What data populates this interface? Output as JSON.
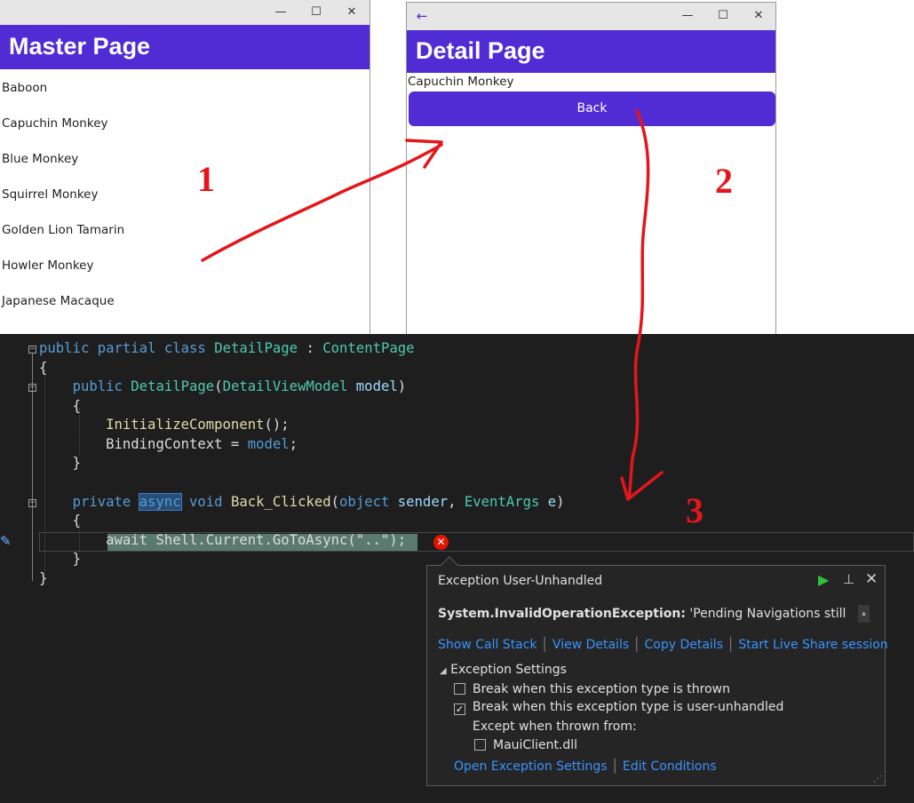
{
  "master_window": {
    "controls": [
      "—",
      "☐",
      "✕"
    ],
    "header": "Master Page",
    "items": [
      "Baboon",
      "Capuchin Monkey",
      "Blue Monkey",
      "Squirrel Monkey",
      "Golden Lion Tamarin",
      "Howler Monkey",
      "Japanese Macaque"
    ]
  },
  "detail_window": {
    "back_arrow": "←",
    "controls": [
      "—",
      "☐",
      "✕"
    ],
    "header": "Detail Page",
    "name": "Capuchin Monkey",
    "back_button": "Back"
  },
  "annotations": [
    "1",
    "2",
    "3"
  ],
  "code": {
    "l1_public": "public",
    "l1_partial": "partial",
    "l1_class": "class",
    "l1_name": "DetailPage",
    "l1_colon": " : ",
    "l1_base": "ContentPage",
    "l2": "{",
    "l3_public": "public",
    "l3_ctor": "DetailPage",
    "l3_open": "(",
    "l3_type": "DetailViewModel",
    "l3_param": "model",
    "l3_close": ")",
    "l4": "{",
    "l5_call": "InitializeComponent",
    "l5_rest": "();",
    "l6_prop": "BindingContext = ",
    "l6_val": "model",
    "l6_end": ";",
    "l7": "}",
    "l8_private": "private",
    "l8_async": "async",
    "l8_void": "void",
    "l8_method": "Back_Clicked",
    "l8_open": "(",
    "l8_object": "object",
    "l8_sender": "sender",
    "l8_comma": ", ",
    "l8_eventargs": "EventArgs",
    "l8_e": "e",
    "l8_close": ")",
    "l9": "{",
    "l10": "await Shell.Current.GoToAsync(\"..\");",
    "l11": "}",
    "l12": "}"
  },
  "exception": {
    "title": "Exception User-Unhandled",
    "type": "System.InvalidOperationException:",
    "message": "'Pending Navigations still",
    "links": [
      "Show Call Stack",
      "View Details",
      "Copy Details",
      "Start Live Share session"
    ],
    "settings_label": "Exception Settings",
    "break_thrown": "Break when this exception type is thrown",
    "break_unhandled": "Break when this exception type is user-unhandled",
    "except_label": "Except when thrown from:",
    "module": "MauiClient.dll",
    "open_settings": "Open Exception Settings",
    "edit_conditions": "Edit Conditions",
    "break_thrown_checked": false,
    "break_unhandled_checked": true,
    "module_checked": false
  }
}
